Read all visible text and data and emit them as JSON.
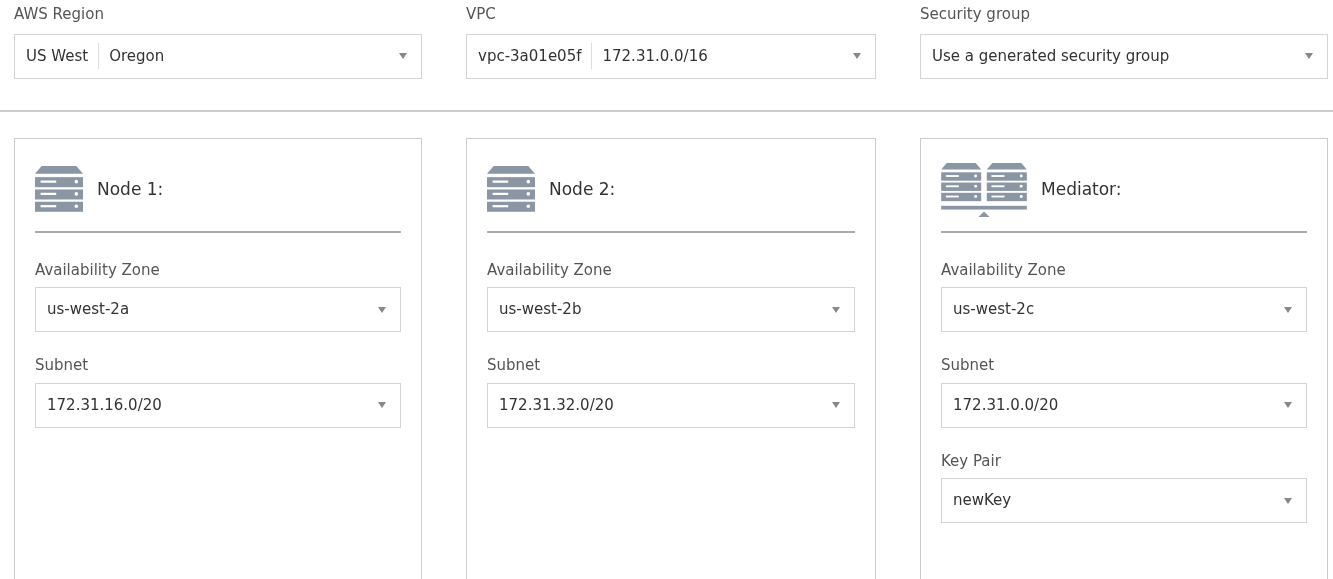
{
  "top_fields": [
    {
      "label": "AWS Region",
      "parts": [
        "US West",
        "Oregon"
      ]
    },
    {
      "label": "VPC",
      "parts": [
        "vpc-3a01e05f",
        "172.31.0.0/16"
      ]
    },
    {
      "label": "Security group",
      "parts": [
        "Use a generated security group"
      ]
    }
  ],
  "panels": [
    {
      "kind": "node",
      "title": "Node 1:",
      "fields": [
        {
          "label": "Availability Zone",
          "value": "us-west-2a"
        },
        {
          "label": "Subnet",
          "value": "172.31.16.0/20"
        }
      ]
    },
    {
      "kind": "node",
      "title": "Node 2:",
      "fields": [
        {
          "label": "Availability Zone",
          "value": "us-west-2b"
        },
        {
          "label": "Subnet",
          "value": "172.31.32.0/20"
        }
      ]
    },
    {
      "kind": "mediator",
      "title": "Mediator:",
      "fields": [
        {
          "label": "Availability Zone",
          "value": "us-west-2c"
        },
        {
          "label": "Subnet",
          "value": "172.31.0.0/20"
        },
        {
          "label": "Key Pair",
          "value": "newKey"
        }
      ]
    }
  ]
}
